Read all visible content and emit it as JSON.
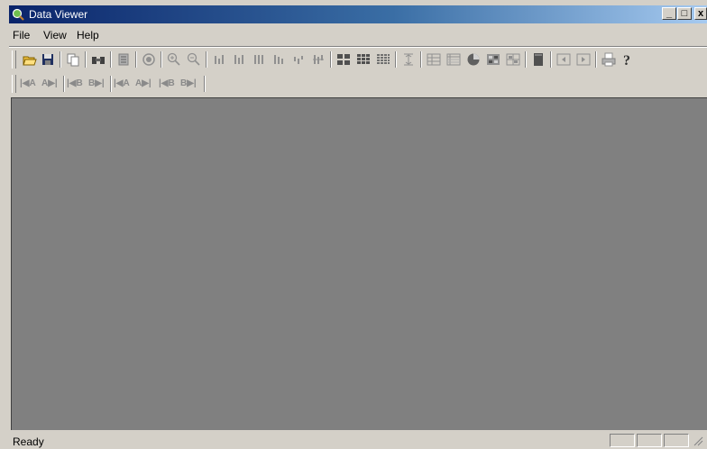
{
  "window": {
    "title": "Data Viewer",
    "title_bar_gradient_start": "#0a246a",
    "title_bar_gradient_end": "#a6caf0"
  },
  "caption_buttons": {
    "minimize": "_",
    "maximize": "□",
    "close": "x"
  },
  "menu": {
    "items": [
      "File",
      "View",
      "Help"
    ]
  },
  "toolbar_icons": [
    "open-folder-icon",
    "save-icon",
    "copy-icon",
    "find-icon",
    "filter-icon",
    "target-icon",
    "zoom-in-icon",
    "zoom-out-icon",
    "bars-icon-1",
    "bars-icon-2",
    "bars-icon-3",
    "bars-icon-4",
    "bars-icon-5",
    "bars-icon-6",
    "grid-2x2-icon",
    "grid-3x3-icon",
    "grid-4x4-icon",
    "fit-vertical-icon",
    "table-icon",
    "sheet-icon",
    "pie-icon",
    "palette-icon",
    "matrix-icon",
    "book-icon",
    "back-icon",
    "forward-icon",
    "print-icon",
    "help-icon"
  ],
  "nav_toolbar": {
    "buttons": [
      "|◀A",
      "A▶|",
      "|◀B",
      "B▶|",
      "|◀A",
      "A▶|",
      "|◀B",
      "B▶|"
    ]
  },
  "status": {
    "text": "Ready"
  },
  "colors": {
    "workspace": "#808080",
    "chrome": "#d4d0c8"
  }
}
